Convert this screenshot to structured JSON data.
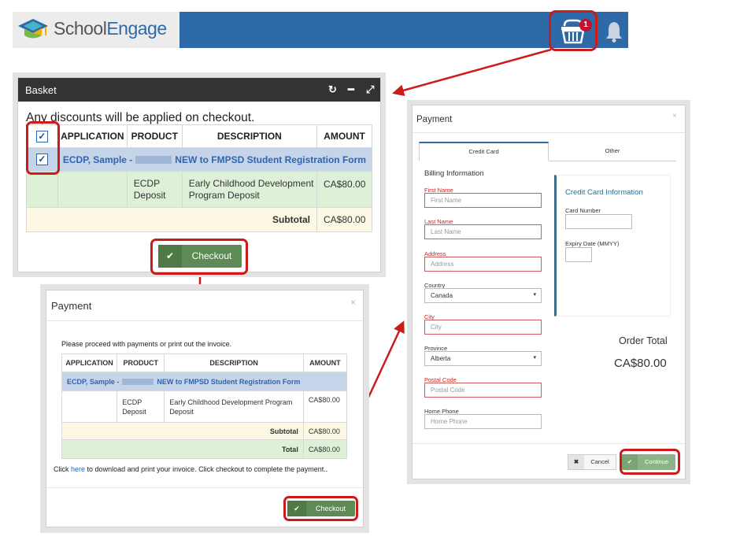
{
  "colors": {
    "brand_blue": "#2e6aa8",
    "highlight_red": "#cc1b1b",
    "checkout_green": "#5e8a56",
    "badge_red": "#c8102e"
  },
  "header": {
    "logo_prefix": "School",
    "logo_suffix": "Engage",
    "basket_count": "1"
  },
  "basket": {
    "title": "Basket",
    "note": "Any discounts will be applied on checkout.",
    "columns": [
      "APPLICATION",
      "PRODUCT",
      "DESCRIPTION",
      "AMOUNT"
    ],
    "application_prefix": "ECDP, Sample -",
    "application_suffix": "NEW to FMPSD Student Registration Form",
    "product_line1": "ECDP",
    "product_line2": "Deposit",
    "description_line1": "Early Childhood Development",
    "description_line2": "Program Deposit",
    "amount": "CA$80.00",
    "subtotal_label": "Subtotal",
    "subtotal_value": "CA$80.00",
    "checkout_label": "Checkout"
  },
  "payment1": {
    "title": "Payment",
    "intro": "Please proceed with payments or print out the invoice.",
    "columns": [
      "APPLICATION",
      "PRODUCT",
      "DESCRIPTION",
      "AMOUNT"
    ],
    "application_prefix": "ECDP, Sample -",
    "application_suffix": "NEW to FMPSD Student Registration Form",
    "product_line1": "ECDP",
    "product_line2": "Deposit",
    "description_line1": "Early Childhood Development Program",
    "description_line2": "Deposit",
    "amount": "CA$80.00",
    "subtotal_label": "Subtotal",
    "subtotal_value": "CA$80.00",
    "total_label": "Total",
    "total_value": "CA$80.00",
    "footer_before": "Click",
    "footer_link": "here",
    "footer_after": "to download and print your invoice. Click checkout to complete the payment..",
    "checkout_label": "Checkout"
  },
  "payment2": {
    "title": "Payment",
    "tab_credit": "Credit Card",
    "tab_other": "Other",
    "billing_title": "Billing Information",
    "first_name_label": "First Name",
    "first_name_placeholder": "First Name",
    "last_name_label": "Last Name",
    "last_name_placeholder": "Last Name",
    "address_label": "Address",
    "address_placeholder": "Address",
    "country_label": "Country",
    "country_value": "Canada",
    "city_label": "City",
    "city_placeholder": "City",
    "province_label": "Province",
    "province_value": "Alberta",
    "postal_label": "Postal Code",
    "postal_placeholder": "Postal Code",
    "phone_label": "Home Phone",
    "phone_placeholder": "Home Phone",
    "cc_title": "Credit Card Information",
    "card_number_label": "Card Number",
    "expiry_label": "Expiry Date (MMYY)",
    "order_total_label": "Order Total",
    "order_total_value": "CA$80.00",
    "cancel_label": "Cancel",
    "continue_label": "Continue"
  }
}
